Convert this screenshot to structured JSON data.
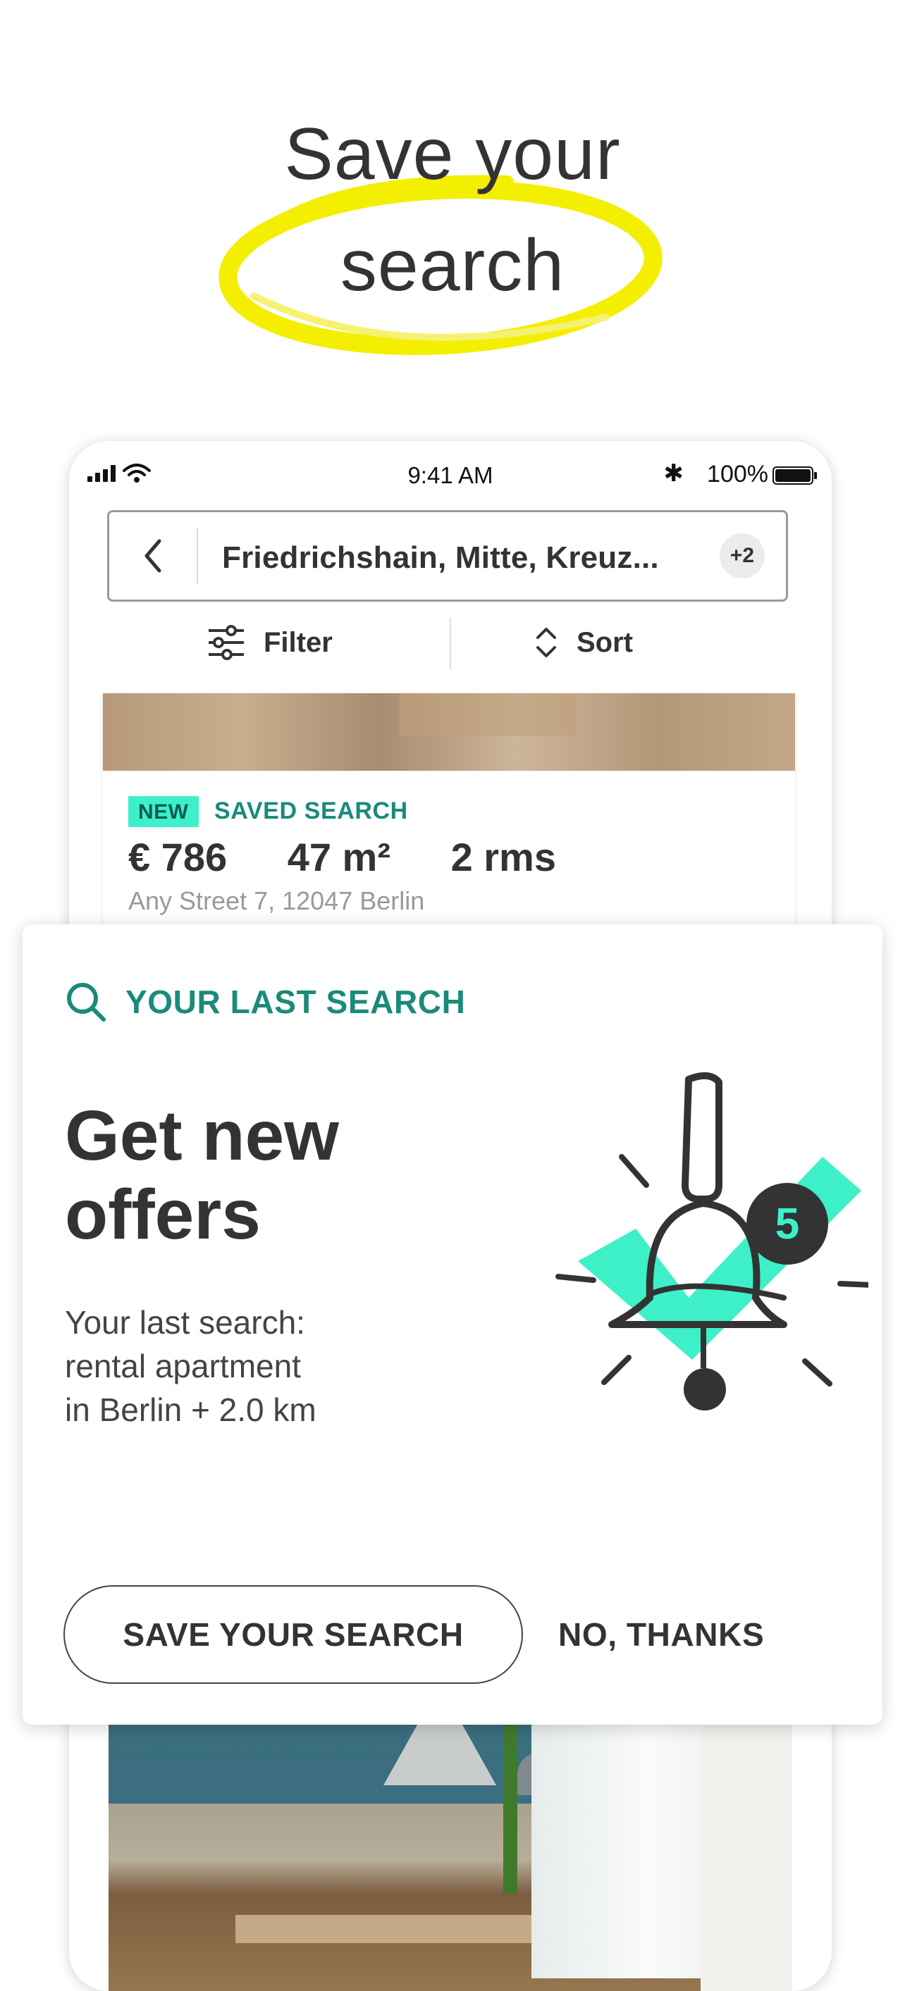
{
  "headline": {
    "line1": "Save your",
    "line2": "search"
  },
  "colors": {
    "accent_yellow": "#f4ee00",
    "teal": "#1a8a7a",
    "mint": "#3df0c8",
    "text_dark": "#333333"
  },
  "status_bar": {
    "time": "9:41 AM",
    "battery": "100%",
    "bluetooth": "bluetooth-icon",
    "signal": "signal-icon",
    "wifi": "wifi-icon"
  },
  "search": {
    "query": "Friedrichshain, Mitte, Kreuz...",
    "extra_count": "+2"
  },
  "toolbar": {
    "filter_label": "Filter",
    "sort_label": "Sort"
  },
  "listing": {
    "new_badge": "NEW",
    "saved_label": "SAVED SEARCH",
    "price": "€ 786",
    "area": "47 m²",
    "rooms": "2 rms",
    "address": "Any Street 7, 12047 Berlin"
  },
  "sheet": {
    "section_label": "YOUR LAST SEARCH",
    "title_line1": "Get new",
    "title_line2": "offers",
    "desc_line1": "Your last search:",
    "desc_line2": "rental apartment",
    "desc_line3": "in Berlin + 2.0 km",
    "bell_count": "5",
    "save_button": "SAVE YOUR SEARCH",
    "dismiss_button": "NO, THANKS"
  }
}
